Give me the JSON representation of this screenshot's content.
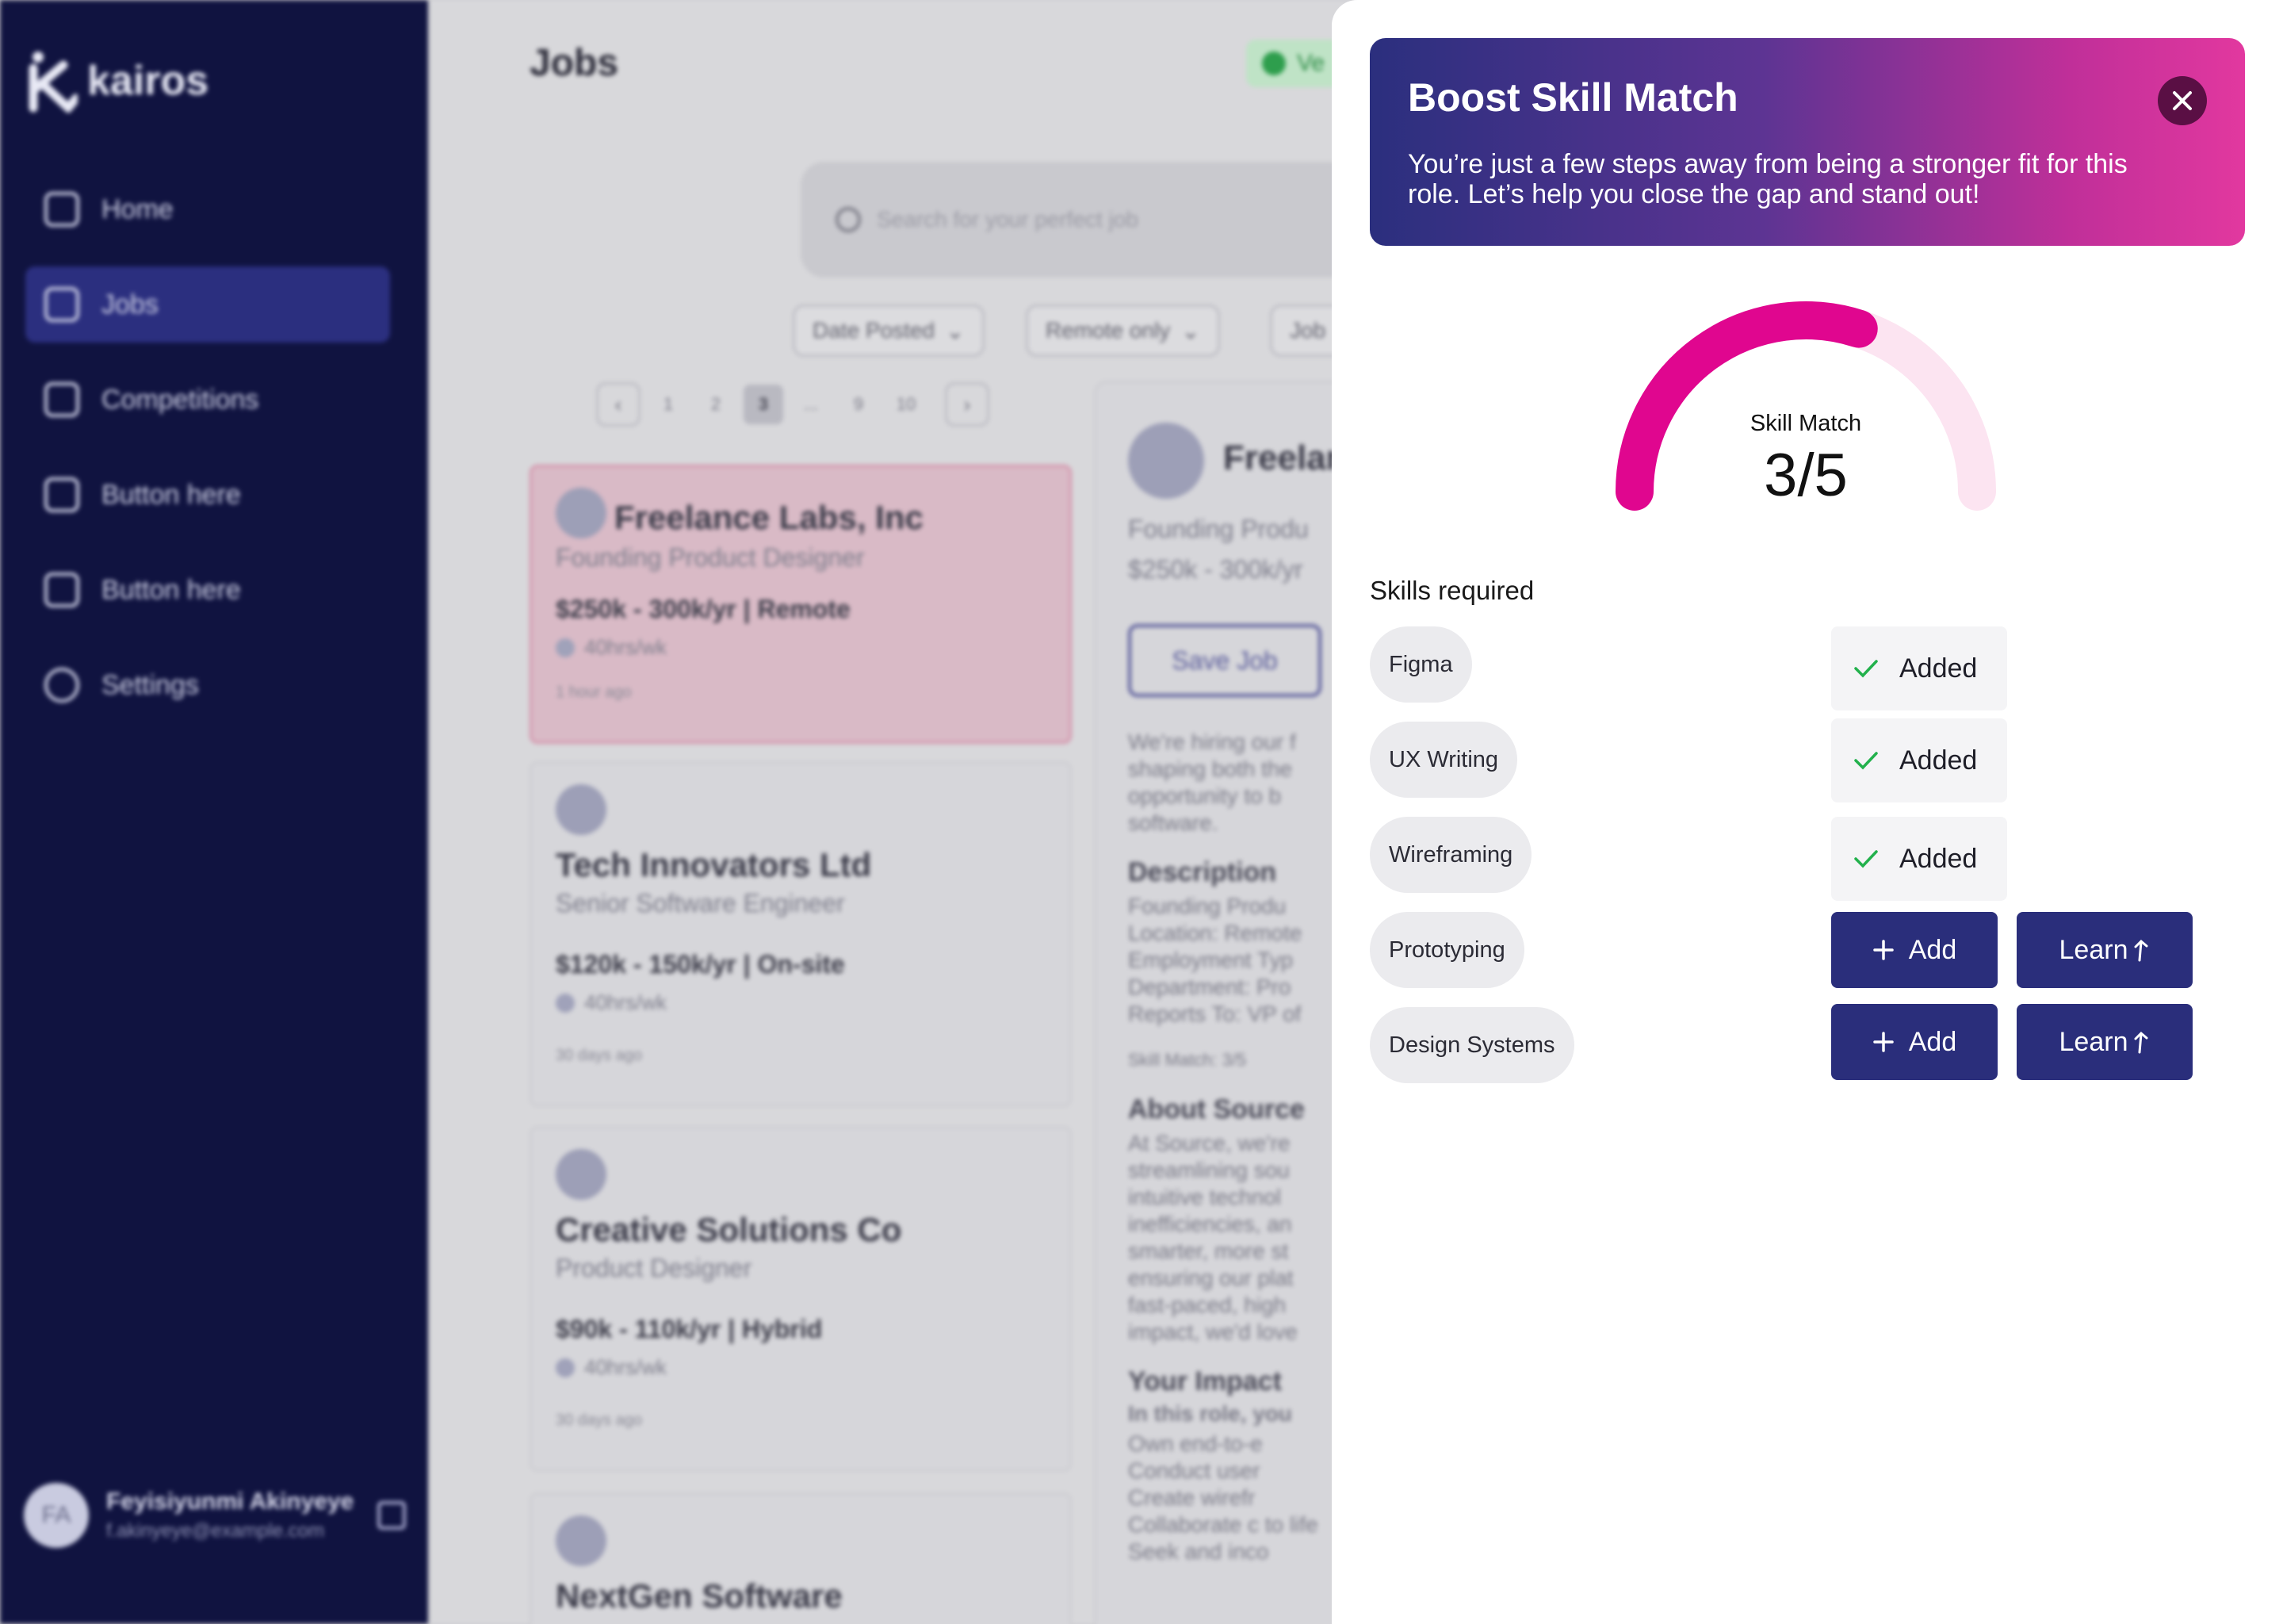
{
  "sidebar": {
    "brand": "kairos",
    "items": [
      {
        "label": "Home",
        "icon": "home-icon"
      },
      {
        "label": "Jobs",
        "icon": "briefcase-icon",
        "active": true
      },
      {
        "label": "Competitions",
        "icon": "trophy-icon"
      },
      {
        "label": "Button here",
        "icon": "briefcase-icon"
      },
      {
        "label": "Button here",
        "icon": "briefcase-icon"
      },
      {
        "label": "Settings",
        "icon": "gear-icon"
      }
    ],
    "user": {
      "initials": "FA",
      "name": "Feyisiyunmi Akinyeye",
      "email": "f.akinyeye@example.com"
    }
  },
  "main": {
    "title": "Jobs",
    "verified_label": "Ve",
    "search_placeholder": "Search for your perfect job",
    "filters": [
      "Date Posted",
      "Remote only",
      "Job"
    ],
    "pagination": {
      "pages": [
        "1",
        "2",
        "3",
        "...",
        "9",
        "10"
      ],
      "current": "3"
    },
    "jobs": [
      {
        "company": "Freelance Labs, Inc",
        "role": "Founding Product Designer",
        "pay": "$250k - 300k/yr | Remote",
        "hours": "40hrs/wk",
        "posted": "1 hour ago"
      },
      {
        "company": "Tech Innovators Ltd",
        "role": "Senior Software Engineer",
        "pay": "$120k - 150k/yr | On-site",
        "hours": "40hrs/wk",
        "posted": "30 days ago"
      },
      {
        "company": "Creative Solutions Co",
        "role": "Product Designer",
        "pay": "$90k - 110k/yr | Hybrid",
        "hours": "40hrs/wk",
        "posted": "30 days ago"
      },
      {
        "company": "NextGen Software",
        "role": "",
        "pay": "",
        "hours": "",
        "posted": ""
      }
    ],
    "detail": {
      "company": "Freelan",
      "role": "Founding Produ",
      "pay": "$250k - 300k/yr",
      "save_label": "Save Job",
      "intro": "We're hiring our f shaping both the opportunity to b software.",
      "description_heading": "Description",
      "description": "Founding Produ Location: Remote Employment Typ Department: Pro Reports To: VP of",
      "skill_match_tag": "Skill Match: 3/5",
      "about_heading": "About Source",
      "about": "At Source, we're streamlining sou intuitive technol inefficiencies, an smarter, more st ensuring our plat fast-paced, high impact, we'd love",
      "impact_heading": "Your Impact",
      "impact_sub": "In this role, you",
      "impact_items": [
        "Own end-to-e",
        "Conduct user",
        "Create wirefr",
        "Collaborate c to life",
        "Seek and inco"
      ]
    }
  },
  "drawer": {
    "title": "Boost Skill Match",
    "subtitle": "You’re just a few steps away from being a stronger fit for this role. Let’s help you close the gap and stand out!",
    "gauge": {
      "label": "Skill Match",
      "value_text": "3/5",
      "matched": 3,
      "total": 5,
      "fill_color": "#e0068f",
      "track_color": "#fce4f1"
    },
    "skills_title": "Skills required",
    "added_label": "Added",
    "add_label": "Add",
    "learn_label": "Learn",
    "skills": [
      {
        "name": "Figma",
        "status": "added"
      },
      {
        "name": "UX Writing",
        "status": "added"
      },
      {
        "name": "Wireframing",
        "status": "added"
      },
      {
        "name": "Prototyping",
        "status": "missing"
      },
      {
        "name": "Design Systems",
        "status": "missing"
      }
    ],
    "colors": {
      "primary": "#2a2e7b",
      "accent": "#e2389f",
      "check": "#22b14c"
    }
  }
}
